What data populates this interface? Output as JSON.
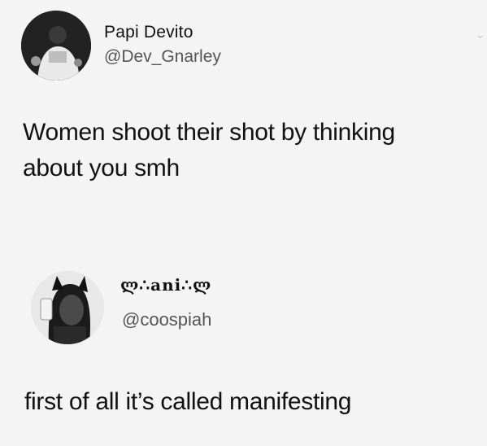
{
  "tweets": [
    {
      "display_name": "Papi Devito",
      "handle": "@Dev_Gnarley",
      "text_line_1": "Women shoot their shot by thinking",
      "text_line_2": "about you smh",
      "avatar_icon": "profile-photo-icon",
      "menu_icon": "chevron-down-icon"
    },
    {
      "display_name": "ლ∴ani∴ლ",
      "handle": "@coospiah",
      "text": "first of all it’s called manifesting",
      "avatar_icon": "profile-photo-icon"
    }
  ],
  "colors": {
    "background": "#f4f4f4",
    "text": "#111111",
    "handle": "#555555"
  }
}
